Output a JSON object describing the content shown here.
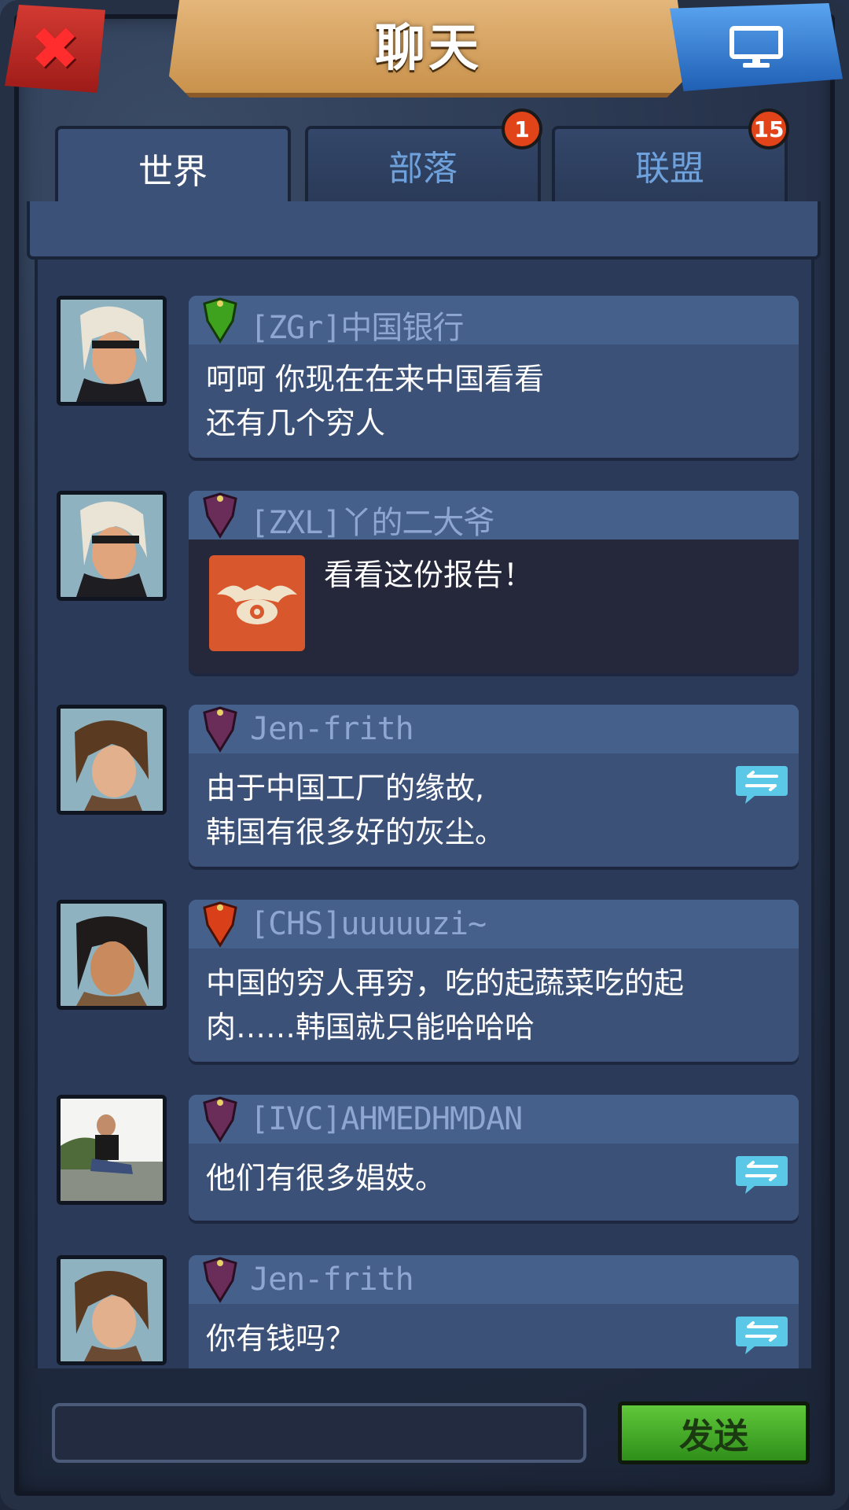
{
  "header": {
    "title": "聊天",
    "close_icon": "close-icon",
    "screen_icon": "monitor-icon"
  },
  "tabs": [
    {
      "label": "世界",
      "active": true,
      "badge": ""
    },
    {
      "label": "部落",
      "active": false,
      "badge": "1"
    },
    {
      "label": "联盟",
      "active": false,
      "badge": "15"
    }
  ],
  "messages": [
    {
      "name": "[ZGr]中国银行",
      "shield_color": "#3fa21f",
      "text": "呵呵 你现在在来中国看看\n还有几个穷人",
      "translate": false
    },
    {
      "name": "[ZXL]丫的二大爷",
      "shield_color": "#6a2c58",
      "text": "看看这份报告！",
      "translate": false,
      "report_icon": "eye-wings-icon"
    },
    {
      "name": "Jen-frith",
      "shield_color": "#6a2c58",
      "text": "由于中国工厂的缘故,\n韩国有很多好的灰尘。",
      "translate": true
    },
    {
      "name": "[CHS]uuuuuzi~",
      "shield_color": "#d9401a",
      "text": "中国的穷人再穷，吃的起蔬菜吃的起\n肉……韩国就只能哈哈哈",
      "translate": false
    },
    {
      "name": "[IVC]AHMEDHMDAN",
      "shield_color": "#6a2c58",
      "text": "他们有很多娼妓。",
      "translate": true
    },
    {
      "name": "Jen-frith",
      "shield_color": "#6a2c58",
      "text": "你有钱吗？",
      "translate": true
    }
  ],
  "composer": {
    "input_value": "",
    "send_label": "发送"
  }
}
